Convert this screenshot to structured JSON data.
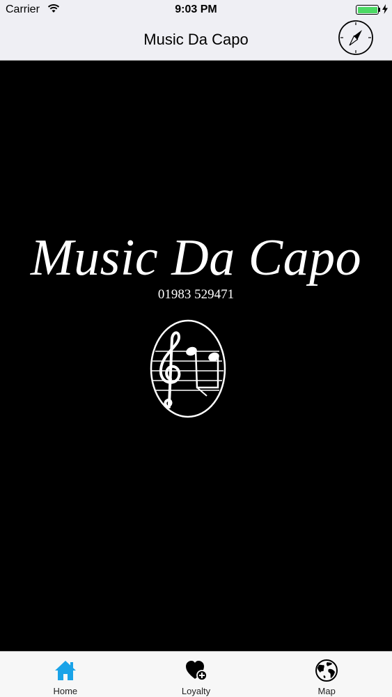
{
  "status_bar": {
    "carrier": "Carrier",
    "time": "9:03 PM",
    "battery_color": "#4cd964"
  },
  "nav": {
    "title": "Music Da Capo",
    "right_icon": "compass-icon"
  },
  "content": {
    "logo_title": "Music Da Capo",
    "logo_phone": "01983 529471",
    "logo_emblem": "treble-clef-note-emblem"
  },
  "tabs": [
    {
      "label": "Home",
      "icon": "home-icon",
      "active": true,
      "color": "#1aa3e8"
    },
    {
      "label": "Loyalty",
      "icon": "heart-plus-icon",
      "active": false,
      "color": "#000000"
    },
    {
      "label": "Map",
      "icon": "globe-icon",
      "active": false,
      "color": "#000000"
    }
  ]
}
